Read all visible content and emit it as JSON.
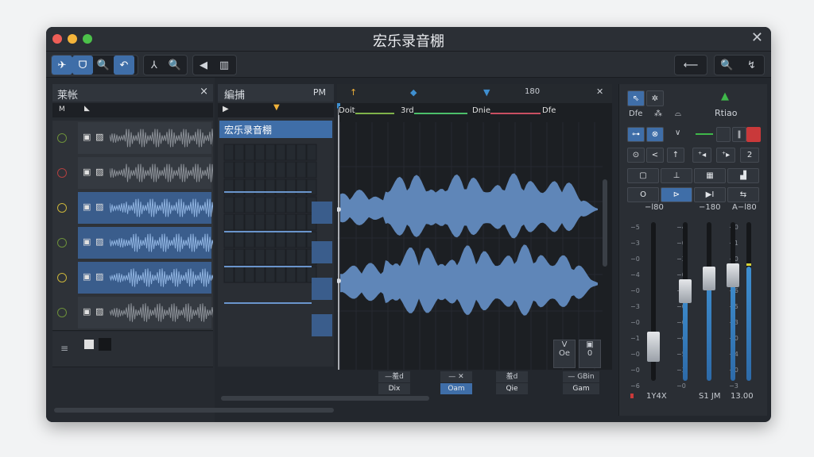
{
  "window": {
    "title": "宏乐录音棚",
    "close_icon": "✕"
  },
  "toolbar": {
    "group1": [
      "✈",
      "ᗜ",
      "🔍",
      "↶"
    ],
    "group2": [
      "⅄",
      "🔍"
    ],
    "group3": [
      "◀",
      "▥"
    ],
    "right": [
      "⟵",
      "🔍",
      "↯"
    ]
  },
  "track_panel": {
    "title": "莱帐",
    "close": "×",
    "tracks": [
      {
        "selected": false,
        "led": "#6c8f3a"
      },
      {
        "selected": false,
        "led": "#b04040"
      },
      {
        "selected": true,
        "led": "#c9b43a"
      },
      {
        "selected": true,
        "led": "#6c8f3a"
      },
      {
        "selected": true,
        "led": "#c9b43a"
      },
      {
        "selected": false,
        "led": "#6c8f3a"
      }
    ],
    "bottom_row_icon": "≡"
  },
  "region_panel": {
    "title": "編捕",
    "badge": "PM",
    "region_label": "宏乐录音棚"
  },
  "timeline": {
    "marker_value": "180",
    "sections": [
      "Doit",
      "3rd",
      "Dnie",
      "Dfe"
    ],
    "mini_buttons": [
      {
        "icon": "V",
        "text": "Oe"
      },
      {
        "icon": "▣",
        "text": "0"
      }
    ]
  },
  "bottom_controls": [
    {
      "top": "—羞d",
      "bottom": "Dix",
      "active": false
    },
    {
      "top": "— ✕",
      "bottom": "Oam",
      "active": true
    },
    {
      "top": "羞d",
      "bottom": "Qie",
      "active": false
    },
    {
      "top": "— GBin",
      "bottom": "Gam",
      "active": false
    }
  ],
  "inspector": {
    "title": "Rtiao",
    "play_glyph": "▲",
    "row1": [
      "⇖",
      "✲"
    ],
    "row2": [
      "Dfe",
      "⁂",
      "⌓"
    ],
    "row3": [
      "⊶",
      "⊗",
      "∨"
    ],
    "row4": [
      "⊙",
      "<",
      "↑",
      "⁺◂",
      "⁺▸",
      "2"
    ],
    "row5": [
      "▢",
      "⊥",
      "▦",
      "▟"
    ],
    "row6": [
      "O",
      "⊳",
      "▶I",
      "⇆"
    ],
    "fader_labels_top": [
      "−l80",
      "−180",
      "A−l80"
    ],
    "fader_labels_bottom": [
      "1Y4X",
      "S1 JM",
      "13.00"
    ],
    "fader_levels": [
      0.27,
      0.6,
      0.68,
      0.7,
      0.72
    ]
  }
}
